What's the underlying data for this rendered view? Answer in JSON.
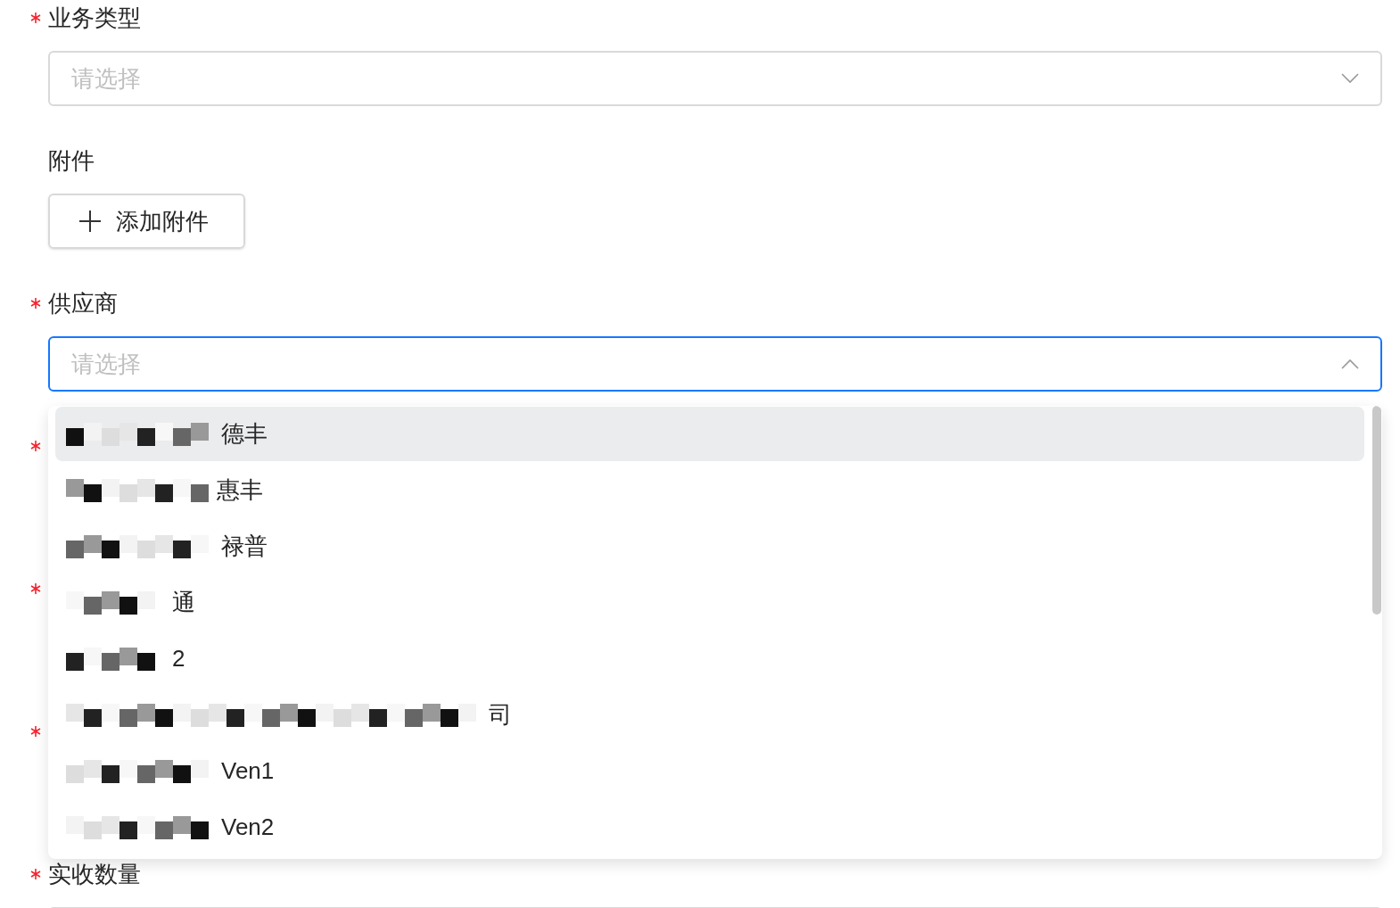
{
  "fields": [
    {
      "kind": "select",
      "label": "业务类型",
      "required": true,
      "placeholder": "请选择",
      "open": false
    },
    {
      "kind": "upload",
      "label": "附件",
      "required": false,
      "button": "添加附件"
    },
    {
      "kind": "select",
      "label": "供应商",
      "required": true,
      "placeholder": "请选择",
      "open": true
    },
    {
      "kind": "hidden",
      "required": true
    },
    {
      "kind": "hidden",
      "required": true
    },
    {
      "kind": "hidden",
      "required": true
    },
    {
      "kind": "partial",
      "label": "实收数量",
      "required": true
    }
  ],
  "dropdown": {
    "options": [
      {
        "text": "德丰",
        "selected": true
      },
      {
        "text": "惠丰",
        "selected": false
      },
      {
        "text": "禄普",
        "selected": false
      },
      {
        "text": "通",
        "selected": false
      },
      {
        "text": "2",
        "selected": false
      },
      {
        "text": "司",
        "selected": false
      },
      {
        "text": "Ven1",
        "selected": false
      },
      {
        "text": "Ven2",
        "selected": false
      }
    ]
  }
}
